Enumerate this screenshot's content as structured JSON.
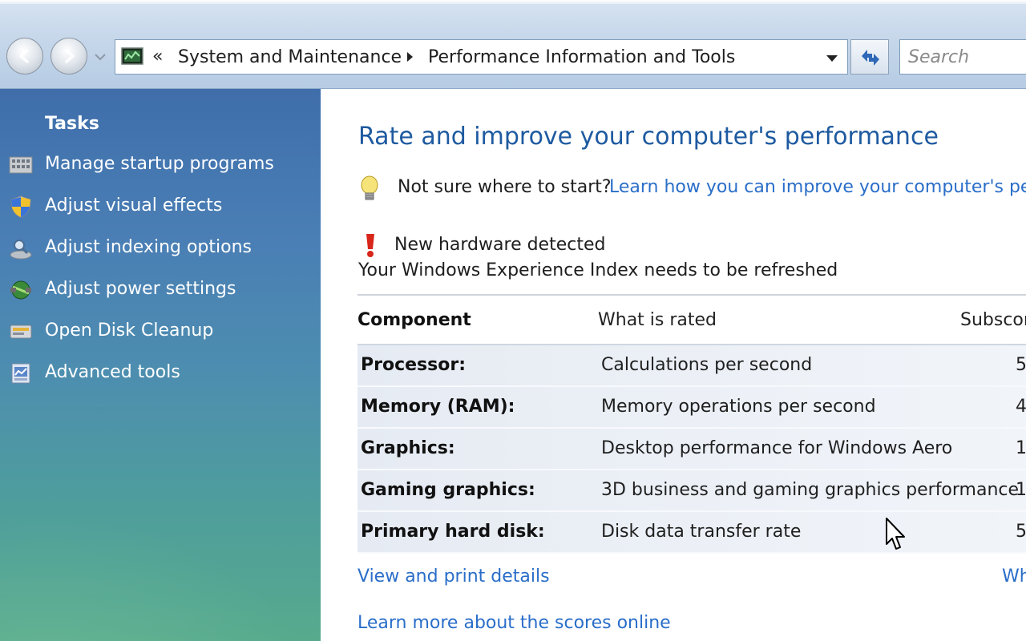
{
  "nav": {
    "breadcrumbs": [
      "System and Maintenance",
      "Performance Information and Tools"
    ],
    "overflow_chevron": "«",
    "search_placeholder": "Search"
  },
  "sidebar": {
    "title": "Tasks",
    "items": [
      {
        "label": "Manage startup programs",
        "icon": "startup-programs-icon"
      },
      {
        "label": "Adjust visual effects",
        "icon": "shield-icon"
      },
      {
        "label": "Adjust indexing options",
        "icon": "indexing-icon"
      },
      {
        "label": "Adjust power settings",
        "icon": "power-icon"
      },
      {
        "label": "Open Disk Cleanup",
        "icon": "disk-cleanup-icon"
      },
      {
        "label": "Advanced tools",
        "icon": "advanced-tools-icon"
      }
    ]
  },
  "main": {
    "title": "Rate and improve your computer's performance",
    "tip": {
      "text": "Not sure where to start?",
      "link": "Learn how you can improve your computer's perf"
    },
    "alert": {
      "title": "New hardware detected",
      "message": "Your Windows Experience Index needs to be refreshed"
    },
    "table": {
      "headers": [
        "Component",
        "What is rated",
        "Subscor"
      ],
      "rows": [
        {
          "component": "Processor:",
          "rated": "Calculations per second",
          "subscore": "5"
        },
        {
          "component": "Memory (RAM):",
          "rated": "Memory operations per second",
          "subscore": "4"
        },
        {
          "component": "Graphics:",
          "rated": "Desktop performance for Windows Aero",
          "subscore": "1"
        },
        {
          "component": "Gaming graphics:",
          "rated": "3D business and gaming graphics performance",
          "subscore": "1"
        },
        {
          "component": "Primary hard disk:",
          "rated": "Disk data transfer rate",
          "subscore": "5"
        }
      ]
    },
    "links": {
      "view_print": "View and print details",
      "what": "Wh",
      "learn_more": "Learn more about the scores online"
    }
  },
  "colors": {
    "link": "#2a6ec9",
    "heading": "#1e5aa0",
    "sidebar_top": "#3f6eab",
    "sidebar_bottom": "#57aa8c"
  }
}
